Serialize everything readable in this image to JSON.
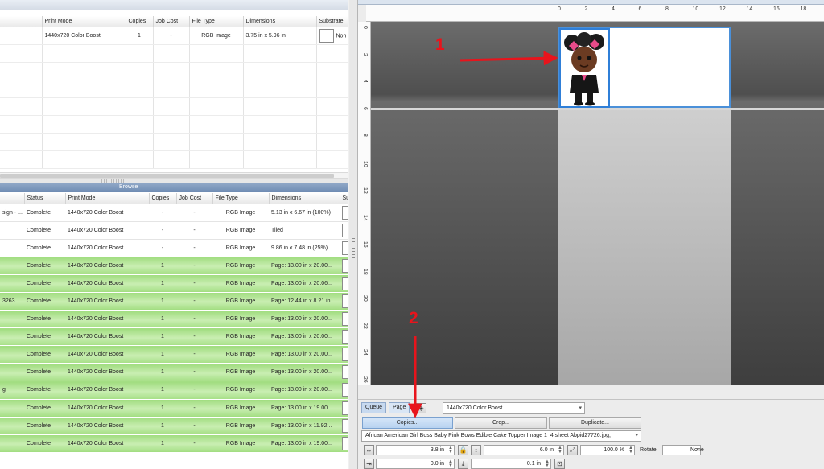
{
  "queue": {
    "columns": [
      "",
      "Print Mode",
      "Copies",
      "Job Cost",
      "File Type",
      "Dimensions",
      "Substrate"
    ],
    "rows": [
      {
        "name": "",
        "print_mode": "1440x720 Color Boost",
        "copies": "1",
        "job_cost": "-",
        "file_type": "RGB Image",
        "dimensions": "3.75 in x 5.96 in",
        "substrate": "Non"
      }
    ]
  },
  "browse_tab": {
    "label": "Browse"
  },
  "history": {
    "columns": [
      "",
      "Status",
      "Print Mode",
      "Copies",
      "Job Cost",
      "File Type",
      "Dimensions",
      "Sub"
    ],
    "rows": [
      {
        "name": "sign - ...",
        "status": "Complete",
        "print_mode": "1440x720 Color Boost",
        "copies": "-",
        "job_cost": "-",
        "file_type": "RGB Image",
        "dimensions": "5.13 in x 6.67 in (100%)",
        "green": false
      },
      {
        "name": "",
        "status": "Complete",
        "print_mode": "1440x720 Color Boost",
        "copies": "-",
        "job_cost": "-",
        "file_type": "RGB Image",
        "dimensions": "Tiled",
        "green": false
      },
      {
        "name": "",
        "status": "Complete",
        "print_mode": "1440x720 Color Boost",
        "copies": "-",
        "job_cost": "-",
        "file_type": "RGB Image",
        "dimensions": "9.86 in x 7.48 in (25%)",
        "green": false
      },
      {
        "name": "",
        "status": "Complete",
        "print_mode": "1440x720 Color Boost",
        "copies": "1",
        "job_cost": "-",
        "file_type": "RGB Image",
        "dimensions": "Page: 13.00 in x 20.00...",
        "green": true
      },
      {
        "name": "",
        "status": "Complete",
        "print_mode": "1440x720 Color Boost",
        "copies": "1",
        "job_cost": "-",
        "file_type": "RGB Image",
        "dimensions": "Page: 13.00 in x 20.06...",
        "green": true
      },
      {
        "name": "3263...",
        "status": "Complete",
        "print_mode": "1440x720 Color Boost",
        "copies": "1",
        "job_cost": "-",
        "file_type": "RGB Image",
        "dimensions": "Page: 12.44 in x 8.21 in",
        "green": true
      },
      {
        "name": "",
        "status": "Complete",
        "print_mode": "1440x720 Color Boost",
        "copies": "1",
        "job_cost": "-",
        "file_type": "RGB Image",
        "dimensions": "Page: 13.00 in x 20.00...",
        "green": true
      },
      {
        "name": "",
        "status": "Complete",
        "print_mode": "1440x720 Color Boost",
        "copies": "1",
        "job_cost": "-",
        "file_type": "RGB Image",
        "dimensions": "Page: 13.00 in x 20.00...",
        "green": true
      },
      {
        "name": "",
        "status": "Complete",
        "print_mode": "1440x720 Color Boost",
        "copies": "1",
        "job_cost": "-",
        "file_type": "RGB Image",
        "dimensions": "Page: 13.00 in x 20.00...",
        "green": true
      },
      {
        "name": "",
        "status": "Complete",
        "print_mode": "1440x720 Color Boost",
        "copies": "1",
        "job_cost": "-",
        "file_type": "RGB Image",
        "dimensions": "Page: 13.00 in x 20.00...",
        "green": true
      },
      {
        "name": "g",
        "status": "Complete",
        "print_mode": "1440x720 Color Boost",
        "copies": "1",
        "job_cost": "-",
        "file_type": "RGB Image",
        "dimensions": "Page: 13.00 in x 20.00...",
        "green": true
      },
      {
        "name": "",
        "status": "Complete",
        "print_mode": "1440x720 Color Boost",
        "copies": "1",
        "job_cost": "-",
        "file_type": "RGB Image",
        "dimensions": "Page: 13.00 in x 19.00...",
        "green": true
      },
      {
        "name": "",
        "status": "Complete",
        "print_mode": "1440x720 Color Boost",
        "copies": "1",
        "job_cost": "-",
        "file_type": "RGB Image",
        "dimensions": "Page: 13.00 in x 11.92...",
        "green": true
      },
      {
        "name": "",
        "status": "Complete",
        "print_mode": "1440x720 Color Boost",
        "copies": "1",
        "job_cost": "-",
        "file_type": "RGB Image",
        "dimensions": "Page: 13.00 in x 19.00...",
        "green": true
      }
    ]
  },
  "rulers": {
    "top": [
      "0",
      "2",
      "4",
      "6",
      "8",
      "10",
      "12",
      "14",
      "16",
      "18"
    ],
    "left": [
      "0",
      "2",
      "4",
      "6",
      "8",
      "10",
      "12",
      "14",
      "16",
      "18",
      "20",
      "22",
      "24",
      "26"
    ]
  },
  "controls": {
    "tab_queue": "Queue",
    "tab_page": "Page",
    "print_mode": "1440x720 Color Boost",
    "copies_button": "Copies...",
    "crop_button": "Crop...",
    "duplicate_button": "Duplicate...",
    "file_name": "African American Girl Boss Baby Pink Bows Edible Cake Topper Image 1_4 sheet Abpid27726.jpg;",
    "width": "3.8 in",
    "height": "6.0 in",
    "scale": "100.0 %",
    "rotate_label": "Rotate:",
    "rotate_value": "None",
    "offset_x": "0.0 in",
    "offset_y": "0.1 in"
  },
  "annotations": {
    "step1": "1",
    "step2": "2"
  },
  "colors": {
    "arrow": "#e8141c",
    "selection": "#2f7fd8",
    "row_green": "#a6df86"
  }
}
